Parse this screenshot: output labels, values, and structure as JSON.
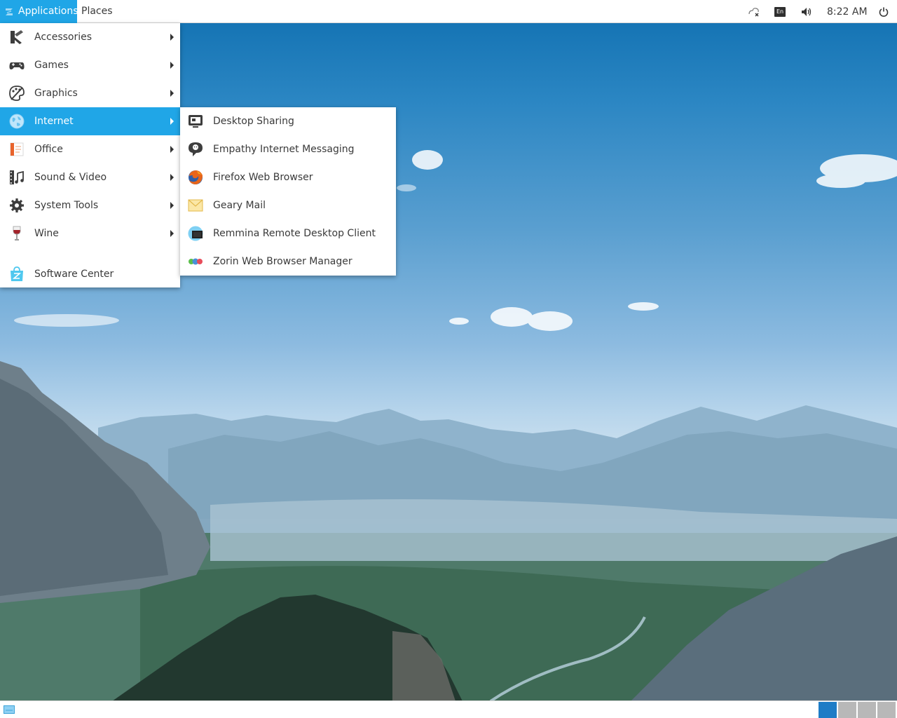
{
  "top_panel": {
    "applications_label": "Applications",
    "places_label": "Places",
    "tray": {
      "network_icon": "network-disconnected-icon",
      "keyboard_layout": "En",
      "volume_icon": "volume-icon",
      "clock": "8:22 AM",
      "power_icon": "power-icon"
    }
  },
  "applications_menu": {
    "items": [
      {
        "label": "Accessories",
        "icon": "accessories-icon",
        "has_submenu": true
      },
      {
        "label": "Games",
        "icon": "gamepad-icon",
        "has_submenu": true
      },
      {
        "label": "Graphics",
        "icon": "graphics-palette-icon",
        "has_submenu": true
      },
      {
        "label": "Internet",
        "icon": "globe-icon",
        "has_submenu": true,
        "active": true
      },
      {
        "label": "Office",
        "icon": "office-document-icon",
        "has_submenu": true
      },
      {
        "label": "Sound & Video",
        "icon": "film-music-icon",
        "has_submenu": true
      },
      {
        "label": "System Tools",
        "icon": "gear-icon",
        "has_submenu": true
      },
      {
        "label": "Wine",
        "icon": "wine-glass-icon",
        "has_submenu": true
      },
      {
        "label": "Software Center",
        "icon": "software-center-icon",
        "has_submenu": false
      }
    ]
  },
  "internet_submenu": {
    "items": [
      {
        "label": "Desktop Sharing",
        "icon": "desktop-sharing-icon"
      },
      {
        "label": "Empathy Internet Messaging",
        "icon": "chat-bubble-icon"
      },
      {
        "label": "Firefox Web Browser",
        "icon": "firefox-icon"
      },
      {
        "label": "Geary Mail",
        "icon": "mail-envelope-icon"
      },
      {
        "label": "Remmina Remote Desktop Client",
        "icon": "remote-desktop-icon"
      },
      {
        "label": "Zorin Web Browser Manager",
        "icon": "browser-manager-icon"
      }
    ]
  },
  "bottom_panel": {
    "show_desktop_icon": "show-desktop-icon",
    "workspace_count": 4,
    "current_workspace": 1
  },
  "colors": {
    "accent": "#20a6e7",
    "current_workspace": "#1e7cc6",
    "workspace": "#b8b8b8",
    "panel": "#ffffff"
  }
}
